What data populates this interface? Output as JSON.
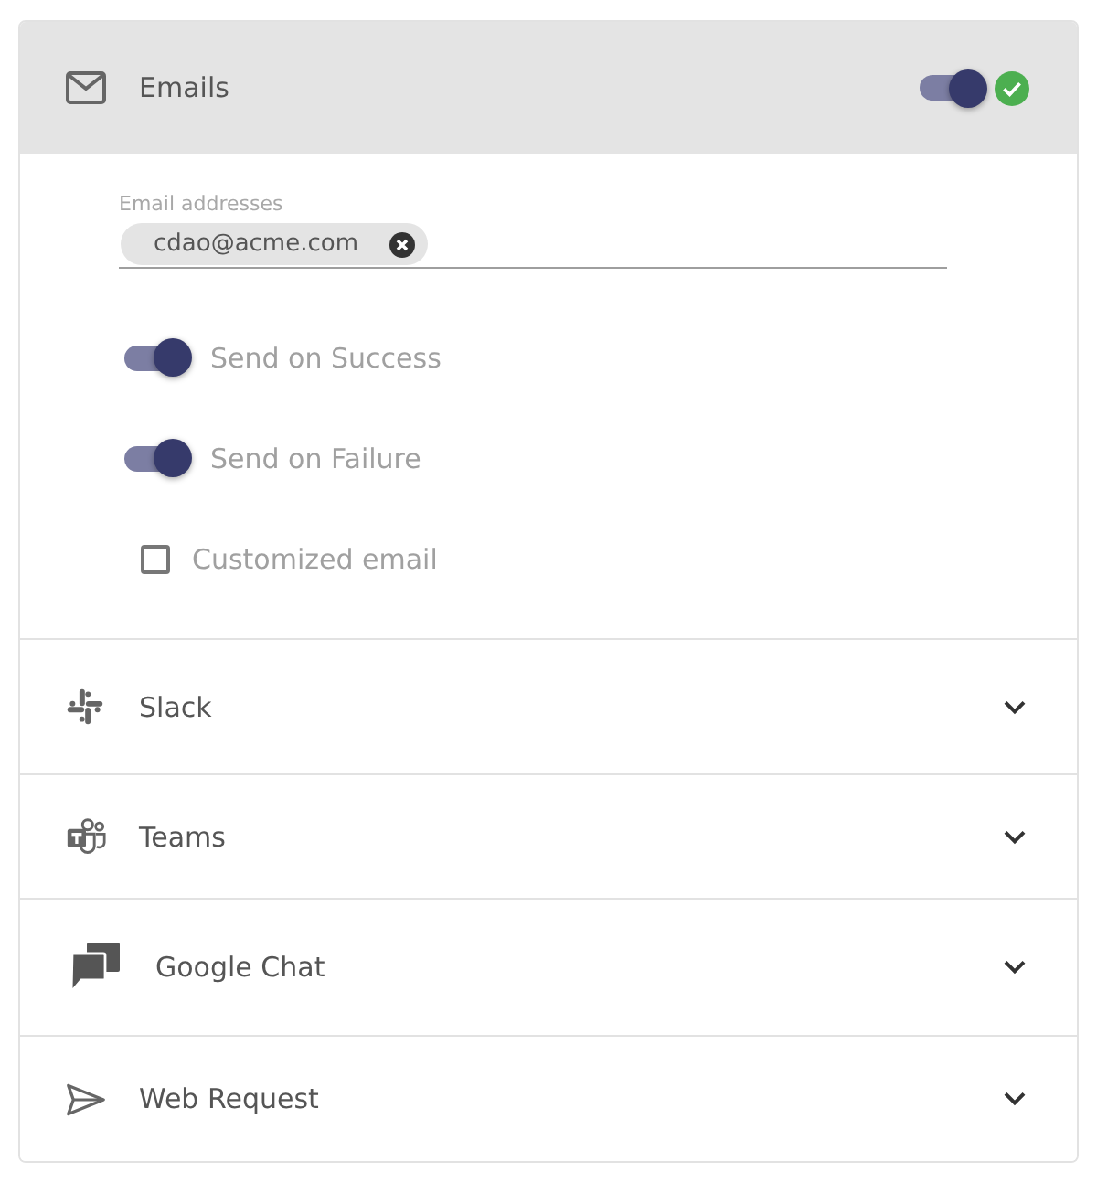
{
  "channels": [
    {
      "kind": "email",
      "name": "Emails",
      "expanded": true,
      "enabled": true,
      "valid": true,
      "recipients": {
        "label": "Email addresses",
        "chips": [
          "cdao@acme.com"
        ]
      },
      "options": [
        {
          "kind": "toggle",
          "label": "Send on Success",
          "on": true
        },
        {
          "kind": "toggle",
          "label": "Send on Failure",
          "on": true
        },
        {
          "kind": "checkbox",
          "label": "Customized email",
          "checked": false
        }
      ]
    },
    {
      "kind": "slack",
      "name": "Slack",
      "expanded": false
    },
    {
      "kind": "teams",
      "name": "Teams",
      "expanded": false
    },
    {
      "kind": "google_chat",
      "name": "Google Chat",
      "expanded": false
    },
    {
      "kind": "webhook",
      "name": "Web Request",
      "expanded": false
    }
  ]
}
